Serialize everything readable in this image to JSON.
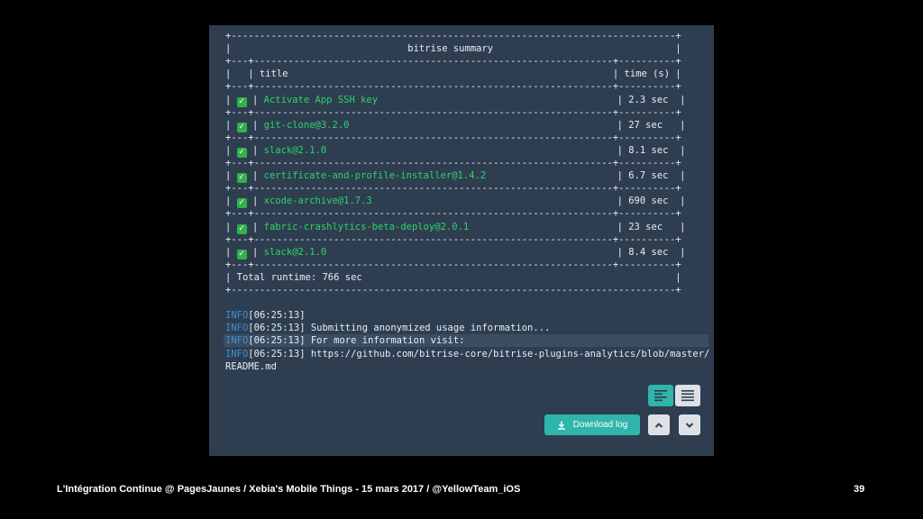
{
  "terminal": {
    "lines": [
      {
        "kind": "border",
        "text": "+------------------------------------------------------------------------------+"
      },
      {
        "kind": "plain",
        "text": "|                               bitrise summary                                |"
      },
      {
        "kind": "border",
        "text": "+---+---------------------------------------------------------------+----------+"
      },
      {
        "kind": "plain",
        "text": "|   | title                                                         | time (s) |"
      },
      {
        "kind": "border",
        "text": "+---+---------------------------------------------------------------+----------+"
      },
      {
        "kind": "step",
        "title": "Activate App SSH key",
        "time": "| 2.3 sec  |"
      },
      {
        "kind": "border",
        "text": "+---+---------------------------------------------------------------+----------+"
      },
      {
        "kind": "step",
        "title": "git-clone@3.2.0",
        "time": "| 27 sec   |"
      },
      {
        "kind": "border",
        "text": "+---+---------------------------------------------------------------+----------+"
      },
      {
        "kind": "step",
        "title": "slack@2.1.0",
        "time": "| 8.1 sec  |"
      },
      {
        "kind": "border",
        "text": "+---+---------------------------------------------------------------+----------+"
      },
      {
        "kind": "step",
        "title": "certificate-and-profile-installer@1.4.2",
        "time": "| 6.7 sec  |"
      },
      {
        "kind": "border",
        "text": "+---+---------------------------------------------------------------+----------+"
      },
      {
        "kind": "step",
        "title": "xcode-archive@1.7.3",
        "time": "| 690 sec  |"
      },
      {
        "kind": "border",
        "text": "+---+---------------------------------------------------------------+----------+"
      },
      {
        "kind": "step",
        "title": "fabric-crashlytics-beta-deploy@2.0.1",
        "time": "| 23 sec   |"
      },
      {
        "kind": "border",
        "text": "+---+---------------------------------------------------------------+----------+"
      },
      {
        "kind": "step",
        "title": "slack@2.1.0",
        "time": "| 8.4 sec  |"
      },
      {
        "kind": "border",
        "text": "+---+---------------------------------------------------------------+----------+"
      },
      {
        "kind": "plain",
        "text": "| Total runtime: 766 sec                                                       |"
      },
      {
        "kind": "border",
        "text": "+------------------------------------------------------------------------------+"
      },
      {
        "kind": "blank",
        "text": ""
      },
      {
        "kind": "info",
        "tag": "INFO",
        "text": "[06:25:13]"
      },
      {
        "kind": "info",
        "tag": "INFO",
        "text": "[06:25:13] Submitting anonymized usage information..."
      },
      {
        "kind": "info",
        "tag": "INFO",
        "text": "[06:25:13] For more information visit:",
        "highlight": true
      },
      {
        "kind": "info",
        "tag": "INFO",
        "text": "[06:25:13] https://github.com/bitrise-core/bitrise-plugins-analytics/blob/master/"
      },
      {
        "kind": "plain",
        "text": "README.md"
      }
    ]
  },
  "controls": {
    "download_label": "Download log",
    "download_icon": "download-icon",
    "view_toggle_icon": "align-left-icon",
    "view_lines_icon": "lines-icon",
    "scroll_up_icon": "chevron-up-icon",
    "scroll_down_icon": "chevron-down-icon",
    "accent_color": "#2fb5a9"
  },
  "footer": {
    "caption": "L'Intégration Continue @ PagesJaunes / Xebia's Mobile Things - 15 mars 2017 / @YellowTeam_iOS",
    "page_number": "39"
  }
}
